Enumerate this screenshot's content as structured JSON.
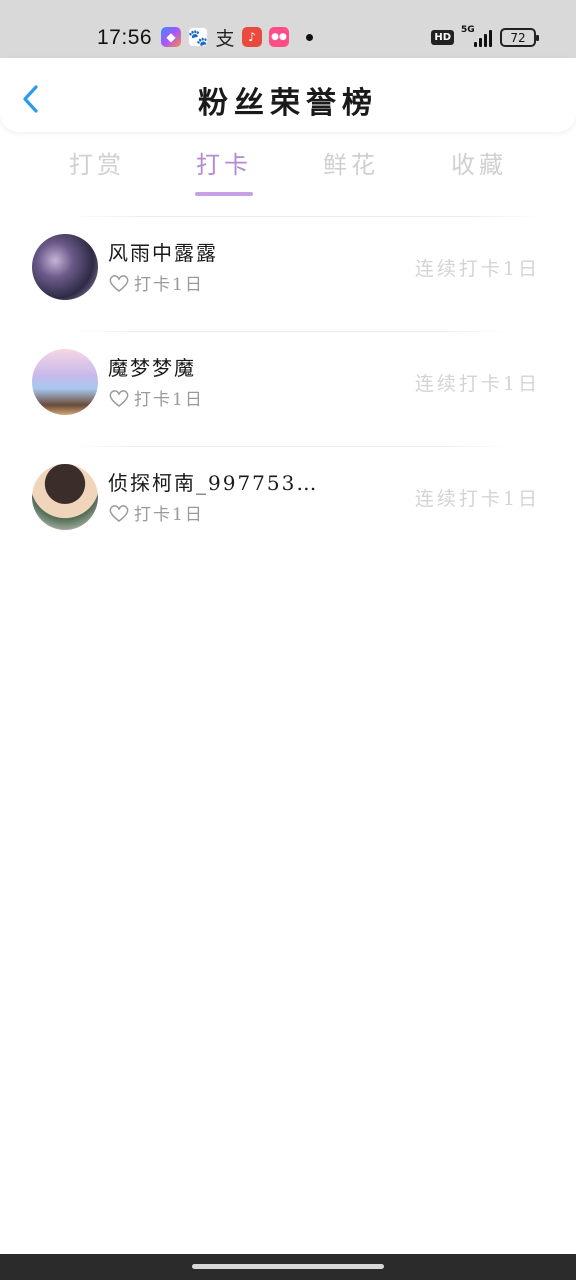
{
  "status_bar": {
    "time": "17:56",
    "notif_zhi": "支",
    "hd": "HD",
    "network": "5G",
    "battery": "72"
  },
  "header": {
    "title": "粉丝荣誉榜"
  },
  "tabs": [
    {
      "label": "打赏",
      "active": false
    },
    {
      "label": "打卡",
      "active": true
    },
    {
      "label": "鲜花",
      "active": false
    },
    {
      "label": "收藏",
      "active": false
    }
  ],
  "fans": [
    {
      "name": "风雨中露露",
      "subtitle": "打卡1日",
      "streak": "连续打卡1日"
    },
    {
      "name": "魔梦梦魔",
      "subtitle": "打卡1日",
      "streak": "连续打卡1日"
    },
    {
      "name": "侦探柯南_9977537···",
      "subtitle": "打卡1日",
      "streak": "连续打卡1日"
    }
  ],
  "colors": {
    "accent": "#b48ad6",
    "indicator": "#c7a0e6",
    "back_arrow": "#2a9bf0"
  }
}
